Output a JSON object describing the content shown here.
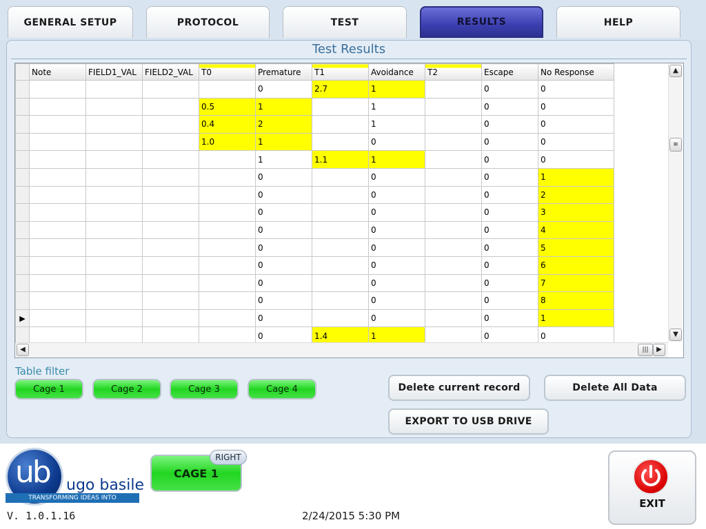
{
  "tabs": [
    {
      "label": "GENERAL SETUP",
      "active": false
    },
    {
      "label": "PROTOCOL",
      "active": false
    },
    {
      "label": "TEST",
      "active": false
    },
    {
      "label": "RESULTS",
      "active": true
    },
    {
      "label": "HELP",
      "active": false
    }
  ],
  "panel": {
    "title": "Test Results"
  },
  "grid": {
    "columns": [
      "Note",
      "FIELD1_VAL",
      "FIELD2_VAL",
      "T0",
      "Premature",
      "T1",
      "Avoidance",
      "T2",
      "Escape",
      "No Response"
    ],
    "highlighted_headers": [
      "T0",
      "T1",
      "T2"
    ],
    "current_row_index": 13,
    "rows": [
      {
        "cells": [
          "",
          "",
          "",
          "",
          "0",
          "2.7",
          "1",
          "",
          "0",
          "0"
        ],
        "highlight": [
          5,
          6
        ]
      },
      {
        "cells": [
          "",
          "",
          "",
          "0.5",
          "1",
          "",
          "1",
          "",
          "0",
          "0"
        ],
        "highlight": [
          3,
          4
        ]
      },
      {
        "cells": [
          "",
          "",
          "",
          "0.4",
          "2",
          "",
          "1",
          "",
          "0",
          "0"
        ],
        "highlight": [
          3,
          4
        ]
      },
      {
        "cells": [
          "",
          "",
          "",
          "1.0",
          "1",
          "",
          "0",
          "",
          "0",
          "0"
        ],
        "highlight": [
          3,
          4
        ]
      },
      {
        "cells": [
          "",
          "",
          "",
          "",
          "1",
          "1.1",
          "1",
          "",
          "0",
          "0"
        ],
        "highlight": [
          5,
          6
        ]
      },
      {
        "cells": [
          "",
          "",
          "",
          "",
          "0",
          "",
          "0",
          "",
          "0",
          "1"
        ],
        "highlight": [
          9
        ]
      },
      {
        "cells": [
          "",
          "",
          "",
          "",
          "0",
          "",
          "0",
          "",
          "0",
          "2"
        ],
        "highlight": [
          9
        ]
      },
      {
        "cells": [
          "",
          "",
          "",
          "",
          "0",
          "",
          "0",
          "",
          "0",
          "3"
        ],
        "highlight": [
          9
        ]
      },
      {
        "cells": [
          "",
          "",
          "",
          "",
          "0",
          "",
          "0",
          "",
          "0",
          "4"
        ],
        "highlight": [
          9
        ]
      },
      {
        "cells": [
          "",
          "",
          "",
          "",
          "0",
          "",
          "0",
          "",
          "0",
          "5"
        ],
        "highlight": [
          9
        ]
      },
      {
        "cells": [
          "",
          "",
          "",
          "",
          "0",
          "",
          "0",
          "",
          "0",
          "6"
        ],
        "highlight": [
          9
        ]
      },
      {
        "cells": [
          "",
          "",
          "",
          "",
          "0",
          "",
          "0",
          "",
          "0",
          "7"
        ],
        "highlight": [
          9
        ]
      },
      {
        "cells": [
          "",
          "",
          "",
          "",
          "0",
          "",
          "0",
          "",
          "0",
          "8"
        ],
        "highlight": [
          9
        ]
      },
      {
        "cells": [
          "",
          "",
          "",
          "",
          "0",
          "",
          "0",
          "",
          "0",
          "1"
        ],
        "highlight": [
          9
        ]
      },
      {
        "cells": [
          "",
          "",
          "",
          "",
          "0",
          "1.4",
          "1",
          "",
          "0",
          "0"
        ],
        "highlight": [
          5,
          6
        ]
      }
    ],
    "highlight_color": "#ffff00"
  },
  "filter": {
    "label": "Table filter",
    "cages": [
      "Cage 1",
      "Cage 2",
      "Cage 3",
      "Cage 4"
    ]
  },
  "actions": {
    "delete_current": "Delete current record",
    "delete_all": "Delete All Data",
    "export": "EXPORT TO USB DRIVE"
  },
  "footer": {
    "logo_mark": "ub",
    "logo_name": "ugo basile",
    "logo_tagline": "TRANSFORMING IDEAS INTO INSTRUMENTS",
    "version": "V. 1.0.1.16",
    "datetime": "2/24/2015 5:30 PM",
    "cage_button": "CAGE 1",
    "cage_side": "RIGHT",
    "exit_label": "EXIT"
  },
  "colors": {
    "active_tab": "#3b3fb0",
    "cage_green": "#22d622",
    "title_blue": "#3a6f9a",
    "exit_red": "#d80000"
  },
  "icons": [
    "scroll-up-icon",
    "scroll-down-icon",
    "scroll-left-icon",
    "scroll-right-icon",
    "row-pointer-icon",
    "power-icon"
  ]
}
